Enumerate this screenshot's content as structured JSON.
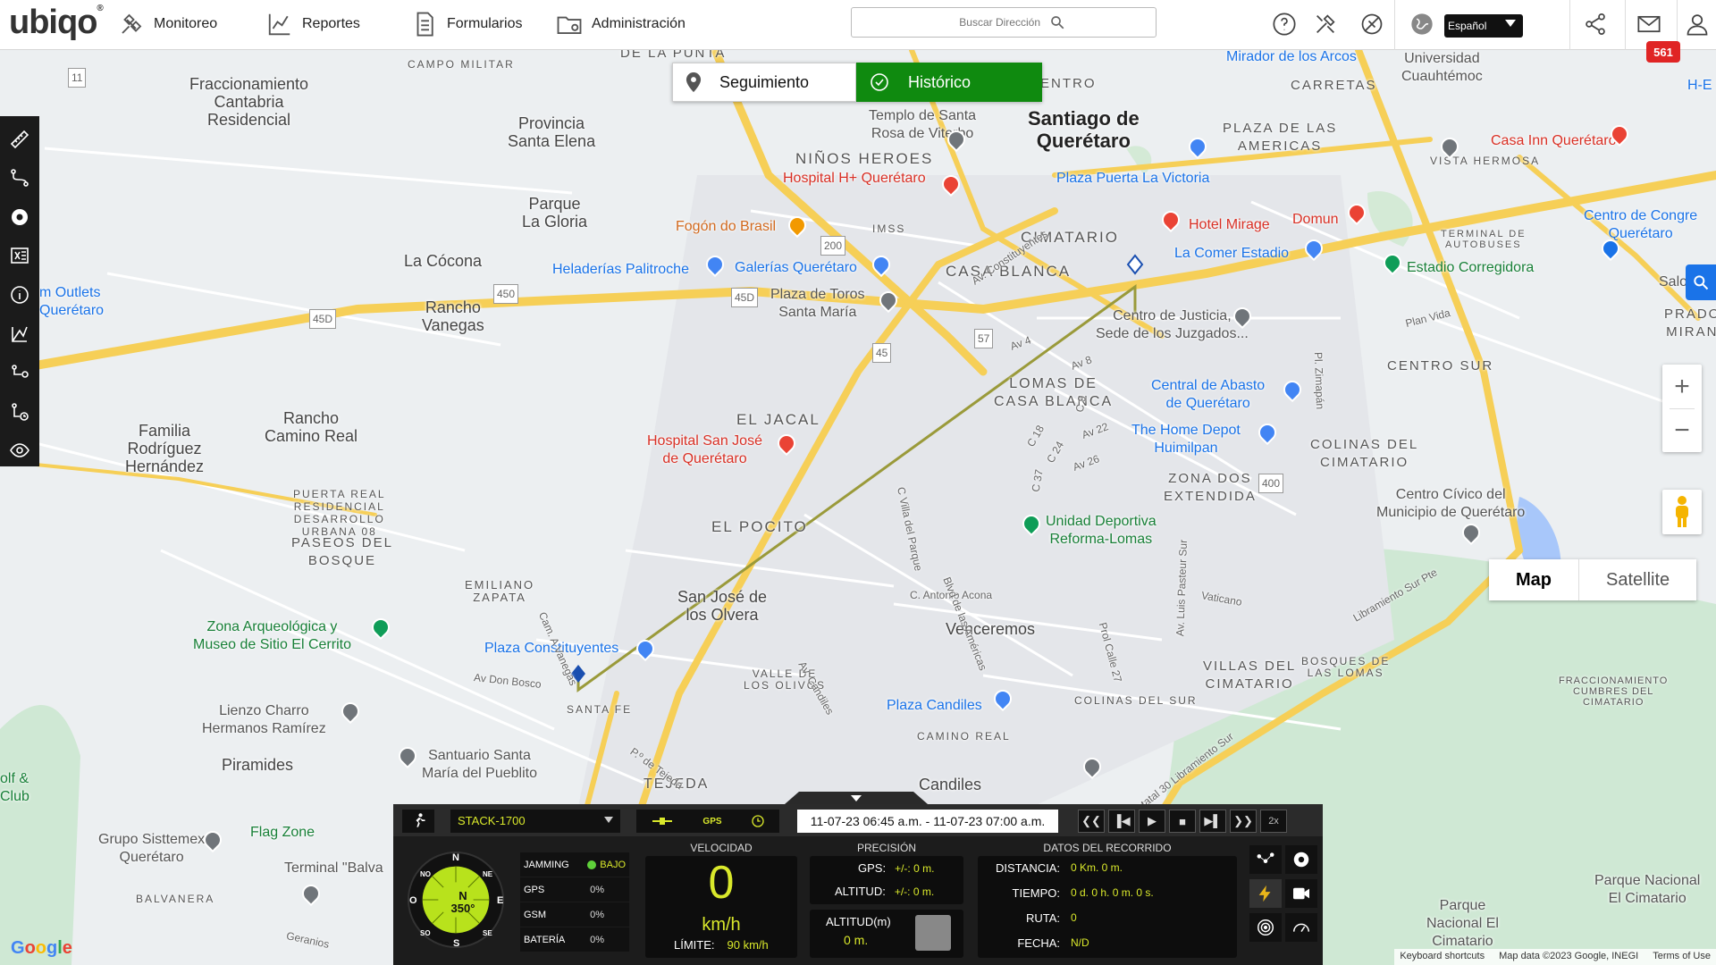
{
  "app": {
    "logo": "ubiqo",
    "logo_mark": "®"
  },
  "nav": {
    "items": [
      {
        "label": "Monitoreo",
        "icon": "satellite-icon"
      },
      {
        "label": "Reportes",
        "icon": "chart-icon"
      },
      {
        "label": "Formularios",
        "icon": "document-icon"
      },
      {
        "label": "Administración",
        "icon": "folder-gear-icon"
      }
    ]
  },
  "search": {
    "placeholder": "Buscar Dirección"
  },
  "language": {
    "selected": "Español"
  },
  "notifications": {
    "count": "561"
  },
  "tabs": {
    "seguimiento": "Seguimiento",
    "historico": "Histórico"
  },
  "map": {
    "type_options": [
      "Map",
      "Satellite"
    ],
    "type_selected": "Map",
    "labels": [
      {
        "text": "Fraccionamiento\nCantabria\nResidencial"
      },
      {
        "text": "Provincia\nSanta Elena"
      },
      {
        "text": "Parque\nLa Gloria"
      },
      {
        "text": "La Cócona"
      },
      {
        "text": "Rancho\nVanegas"
      },
      {
        "text": "Familia\nRodríguez\nHernández"
      },
      {
        "text": "Rancho\nCamino Real"
      },
      {
        "text": "PUERTA REAL\nRESIDENCIAL\nDESARROLLO\nURBANA 08"
      },
      {
        "text": "PASEOS DEL\nBOSQUE"
      },
      {
        "text": "EMILIANO\nZAPATA"
      },
      {
        "text": "Piramides"
      },
      {
        "text": "Santiago de\nQuerétaro"
      },
      {
        "text": "NIÑOS HEROES"
      },
      {
        "text": "CIMATARIO"
      },
      {
        "text": "CASA BLANCA"
      },
      {
        "text": "EL JACAL"
      },
      {
        "text": "LOMAS DE\nCASA BLANCA"
      },
      {
        "text": "EL POCITO"
      },
      {
        "text": "San José de\nlos Olvera"
      },
      {
        "text": "VALLE DE\nLOS OLIVOS"
      },
      {
        "text": "SANTA FE"
      },
      {
        "text": "TEJEDA"
      },
      {
        "text": "Venceremos"
      },
      {
        "text": "Candiles"
      },
      {
        "text": "CAMINO REAL"
      },
      {
        "text": "ZONA DOS\nEXTENDIDA"
      },
      {
        "text": "COLINAS DEL\nCIMATARIO"
      },
      {
        "text": "CENTRO SUR"
      },
      {
        "text": "VILLAS DEL\nCIMATARIO"
      },
      {
        "text": "BOSQUES DE\nLAS LOMAS"
      },
      {
        "text": "COLINAS DEL SUR"
      },
      {
        "text": "PLAZA DE LAS\nAMERICAS"
      },
      {
        "text": "CARRETAS"
      },
      {
        "text": "Universidad\nCuauhtémoc"
      },
      {
        "text": "PRADOS\nMIRAND"
      },
      {
        "text": "Salones de"
      },
      {
        "text": "BALVANERA"
      },
      {
        "text": "CAMPO MILITAR"
      },
      {
        "text": "DE LA PUNTA"
      },
      {
        "text": "ENTRO"
      },
      {
        "text": "IMSS"
      },
      {
        "text": "Parque\nNacional El\nCimatario"
      },
      {
        "text": "FRACCIONAMIENTO\nCUMBRES DEL\nCIMATARIO"
      },
      {
        "text": "VISTA HERMOSA"
      },
      {
        "text": "TERMINAL DE\nAUTOBUSES"
      },
      {
        "text": "H-E"
      }
    ],
    "pois": [
      {
        "text": "Templo de Santa\nRosa de Viterbo",
        "kind": "gray"
      },
      {
        "text": "Hospital H+ Querétaro",
        "kind": "red"
      },
      {
        "text": "Fogón do Brasil",
        "kind": "orange"
      },
      {
        "text": "Heladerías Palitroche",
        "kind": "blue"
      },
      {
        "text": "Galerías Querétaro",
        "kind": "blue"
      },
      {
        "text": "Plaza de Toros\nSanta María",
        "kind": "gray"
      },
      {
        "text": "Plaza Puerta La Victoria",
        "kind": "blue"
      },
      {
        "text": "Hotel Mirage",
        "kind": "red"
      },
      {
        "text": "Domun",
        "kind": "red"
      },
      {
        "text": "La Comer Estadio",
        "kind": "blue"
      },
      {
        "text": "Estadio Corregidora",
        "kind": "green"
      },
      {
        "text": "Centro de Justicia,\nSede de los Juzgados...",
        "kind": "gray"
      },
      {
        "text": "Central de Abasto\nde Querétaro",
        "kind": "blue"
      },
      {
        "text": "The Home Depot\nHuimilpan",
        "kind": "blue"
      },
      {
        "text": "Hospital San José\nde Querétaro",
        "kind": "red"
      },
      {
        "text": "Unidad Deportiva\nReforma-Lomas",
        "kind": "green"
      },
      {
        "text": "Centro Cívico del\nMunicipio de Querétaro",
        "kind": "gray"
      },
      {
        "text": "Plaza Constituyentes",
        "kind": "blue"
      },
      {
        "text": "Plaza Candiles",
        "kind": "blue"
      },
      {
        "text": "Zona Arqueológica y\nMuseo de Sitio El Cerrito",
        "kind": "green"
      },
      {
        "text": "Lienzo Charro\nHermanos Ramírez",
        "kind": "gray"
      },
      {
        "text": "Santuario Santa\nMaría del Pueblito",
        "kind": "gray"
      },
      {
        "text": "Flag Zone",
        "kind": "green"
      },
      {
        "text": "Grupo Sisttemex\nQuerétaro",
        "kind": "gray"
      },
      {
        "text": "Terminal \"Balva",
        "kind": "gray"
      },
      {
        "text": "Casa Inn Querétaro",
        "kind": "red"
      },
      {
        "text": "Mirador de los Arcos",
        "kind": "blue"
      },
      {
        "text": "Centro de Congre\nQuerétaro",
        "kind": "blue"
      },
      {
        "text": "Parque Nacional\nEl Cimatario",
        "kind": "gray"
      },
      {
        "text": "m Outlets\nQuerétaro",
        "kind": "blue"
      },
      {
        "text": "olf &\nClub",
        "kind": "green"
      }
    ],
    "roads": [
      "C. Antonio Acona",
      "Av Don Bosco",
      "Vaticano",
      "Libramiento Sur Pte",
      "Estatal 30 Libramiento Sur",
      "Plan Vida",
      "Av 4",
      "Av 8",
      "C 18",
      "C 24",
      "Av 22",
      "Av 26",
      "C 37",
      "C 9",
      "Pl. Zimapán",
      "Av. Luis Pasteur Sur",
      "Prol Calle 27",
      "Blvd de las Américas",
      "C Villa del Parque",
      "Av. Candiles",
      "Cam. A Vanegas",
      "Av. Constituyentes",
      "P.º de Tejeda",
      "Geranios"
    ],
    "route_shields": [
      "11",
      "450",
      "45",
      "200",
      "57",
      "400",
      "45D",
      "45D"
    ],
    "google_logo": "Google",
    "attribution": [
      "Keyboard shortcuts",
      "Map data ©2023 Google, INEGI",
      "Terms of Use"
    ]
  },
  "panel": {
    "unit": "STACK-1700",
    "signal_gps": "GPS",
    "date_range": "11-07-23 06:45 a.m. - 11-07-23 07:00 a.m.",
    "playback": {
      "speed": "2x"
    },
    "compass": {
      "n": "N",
      "s": "S",
      "e": "E",
      "w": "O",
      "ne": "NE",
      "no": "NO",
      "se": "SE",
      "so": "SO",
      "heading_dir": "N",
      "heading": "350°"
    },
    "status": [
      {
        "key": "JAMMING",
        "value": "BAJO"
      },
      {
        "key": "GPS",
        "value": "0%"
      },
      {
        "key": "GSM",
        "value": "0%"
      },
      {
        "key": "BATERÍA",
        "value": "0%"
      }
    ],
    "velocidad": {
      "title": "VELOCIDAD",
      "value": "0",
      "unit": "km/h",
      "limit_label": "LÍMITE:",
      "limit_value": "90 km/h"
    },
    "precision": {
      "title": "PRECISIÓN",
      "gps_label": "GPS:",
      "gps_value": "+/-: 0 m.",
      "alt_label": "ALTITUD:",
      "alt_value": "+/-: 0 m."
    },
    "altitud": {
      "label": "ALTITUD(m)",
      "value": "0 m."
    },
    "recorrido": {
      "title": "DATOS DEL RECORRIDO",
      "rows": [
        {
          "key": "DISTANCIA:",
          "value": "0 Km. 0 m."
        },
        {
          "key": "TIEMPO:",
          "value": "0 d. 0 h. 0 m. 0 s."
        },
        {
          "key": "RUTA:",
          "value": "0"
        },
        {
          "key": "FECHA:",
          "value": "N/D"
        }
      ]
    }
  },
  "colors": {
    "accent_green": "#0f8a0f",
    "route_line": "#9a9a3a",
    "panel_value": "#d9e82b",
    "badge_red": "#e02424",
    "map_road_yellow": "#f7d154"
  }
}
